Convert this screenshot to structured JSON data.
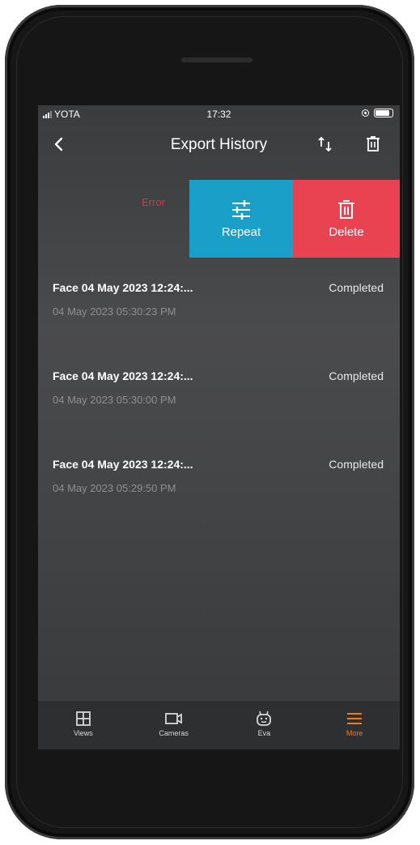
{
  "status_bar": {
    "carrier": "YOTA",
    "time": "17:32"
  },
  "header": {
    "title": "Export History",
    "back_icon": "chevron-left-icon",
    "sort_icon": "sort-arrows-icon",
    "trash_icon": "trash-icon"
  },
  "swiped_item": {
    "status": "Error",
    "actions": [
      {
        "label": "Repeat",
        "icon": "sliders-icon",
        "color": "#1aa0c8"
      },
      {
        "label": "Delete",
        "icon": "trash-icon",
        "color": "#e94352"
      }
    ]
  },
  "items": [
    {
      "name": "Face 04 May 2023 12:24:...",
      "date": "04 May 2023 05:30:23 PM",
      "status": "Completed"
    },
    {
      "name": "Face 04 May 2023 12:24:...",
      "date": "04 May 2023 05:30:00 PM",
      "status": "Completed"
    },
    {
      "name": "Face 04 May 2023 12:24:...",
      "date": "04 May 2023 05:29:50 PM",
      "status": "Completed"
    }
  ],
  "tabs": [
    {
      "label": "Views",
      "icon": "grid-icon",
      "active": false
    },
    {
      "label": "Cameras",
      "icon": "video-camera-icon",
      "active": false
    },
    {
      "label": "Eva",
      "icon": "robot-icon",
      "active": false
    },
    {
      "label": "More",
      "icon": "menu-icon",
      "active": true
    }
  ],
  "colors": {
    "accent": "#f07a22",
    "error": "#d7383f"
  }
}
